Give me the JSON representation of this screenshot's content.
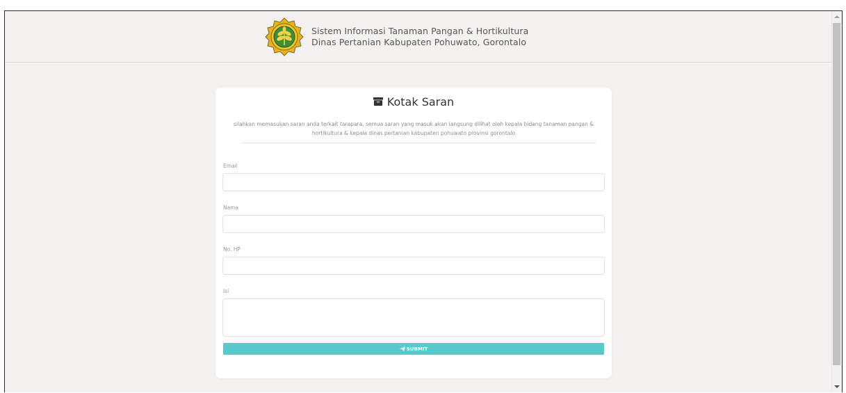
{
  "header": {
    "title_line1": "Sistem Informasi Tanaman Pangan & Hortikultura",
    "title_line2": "Dinas Pertanian Kabupaten Pohuwato, Gorontalo"
  },
  "form": {
    "title": "Kotak Saran",
    "description": "silahkan memasukan saran anda terkait tarapara, semua saran yang masuk akan langsung dilihat oleh kepala bidang tanaman pangan & hortikultura & kepala dinas pertanian kabupaten pohuwato provinsi gorontalo",
    "fields": [
      {
        "label": "Email",
        "value": "",
        "placeholder": ""
      },
      {
        "label": "Nama",
        "value": "",
        "placeholder": ""
      },
      {
        "label": "No. HP",
        "value": "",
        "placeholder": ""
      },
      {
        "label": "Isi",
        "value": "",
        "placeholder": ""
      }
    ],
    "submit_label": "SUBMIT"
  },
  "icons": {
    "logo": "agriculture-department-emblem",
    "title_icon": "archive-icon",
    "submit_icon": "paper-plane-icon"
  },
  "colors": {
    "background": "#f3f2f0",
    "card": "#ffffff",
    "submit_button": "#5ac8cc",
    "emblem_gold": "#e2b324",
    "emblem_green": "#2e7d32"
  }
}
